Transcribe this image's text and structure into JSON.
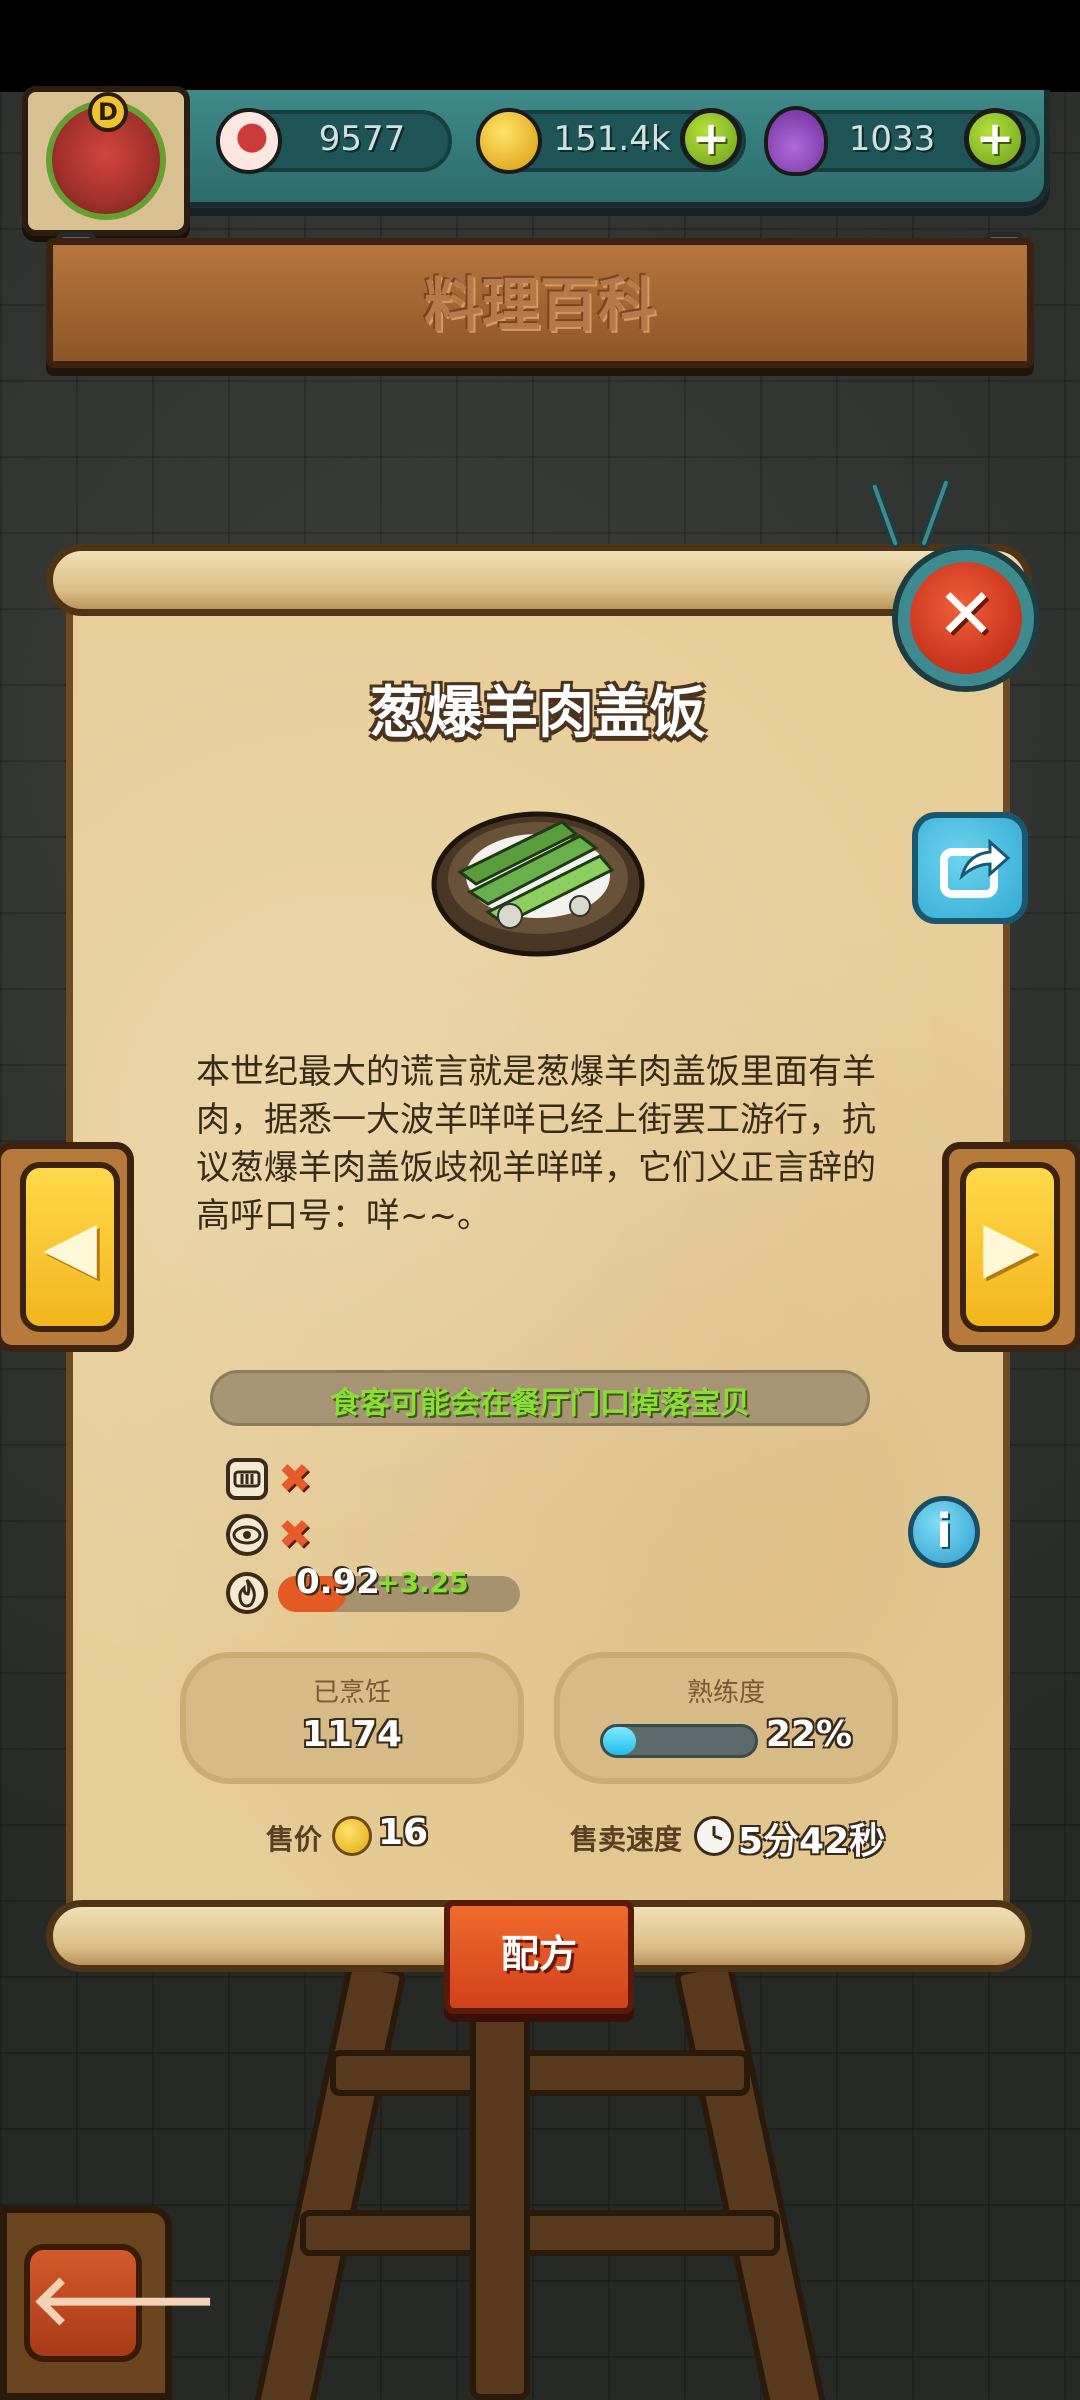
{
  "resources": {
    "eyeballs": "9577",
    "coins": "151.4k",
    "potions": "1033",
    "plus_symbol": "+"
  },
  "avatar": {
    "badge": "D"
  },
  "page_title": "料理百科",
  "close_symbol": "✕",
  "dish": {
    "name": "葱爆羊肉盖饭",
    "description": "本世纪最大的谎言就是葱爆羊肉盖饭里面有羊肉，据悉一大波羊咩咩已经上街罢工游行，抗议葱爆羊肉盖饭歧视羊咩咩，它们义正言辞的高呼口号：咩~~。"
  },
  "nav": {
    "prev_symbol": "◀",
    "next_symbol": "▶"
  },
  "drop_hint": "食客可能会在餐厅门口掉落宝贝",
  "traits": {
    "trait1_status": "✖",
    "trait2_status": "✖",
    "heat_value": "0.92",
    "heat_bonus": "+3.25",
    "heat_fraction": 0.28
  },
  "info_symbol": "i",
  "stats": {
    "cooked_label": "已烹饪",
    "cooked_value": "1174",
    "mastery_label": "熟练度",
    "mastery_value": "22%",
    "mastery_fraction": 0.22
  },
  "sale": {
    "price_label": "售价",
    "price_value": "16",
    "speed_label": "售卖速度",
    "speed_value": "5分42秒"
  },
  "recipe_button": "配方",
  "back_symbol": "🡐",
  "icons": {
    "eyeball": "eyeball-icon",
    "coin": "coin-icon",
    "potion": "potion-icon",
    "share": "share-icon",
    "clock": "clock-icon",
    "fire": "fire-icon"
  },
  "colors": {
    "panel_teal": "#2d6b6c",
    "parchment": "#e7cd98",
    "accent_green": "#8bdd35",
    "close_red": "#c8331d",
    "mastery_cyan": "#22bde6"
  }
}
